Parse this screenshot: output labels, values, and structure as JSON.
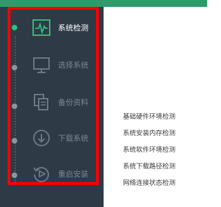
{
  "colors": {
    "sidebar_bg": "#2f3a47",
    "accent": "#2fc07a",
    "highlight_border": "#ff0000",
    "topbar": "#2d9b6a"
  },
  "sidebar": {
    "items": [
      {
        "label": "系统检测",
        "icon": "pulse-monitor-icon",
        "active": true
      },
      {
        "label": "选择系统",
        "icon": "monitor-icon",
        "active": false
      },
      {
        "label": "备份资料",
        "icon": "copy-documents-icon",
        "active": false
      },
      {
        "label": "下载系统",
        "icon": "download-icon",
        "active": false
      },
      {
        "label": "重启安装",
        "icon": "restart-icon",
        "active": false
      }
    ]
  },
  "checks": {
    "items": [
      "基础硬件环境检测",
      "系统安装内存检测",
      "系统软件环境检测",
      "系统下载路径检测",
      "网络连接状态检测"
    ]
  }
}
